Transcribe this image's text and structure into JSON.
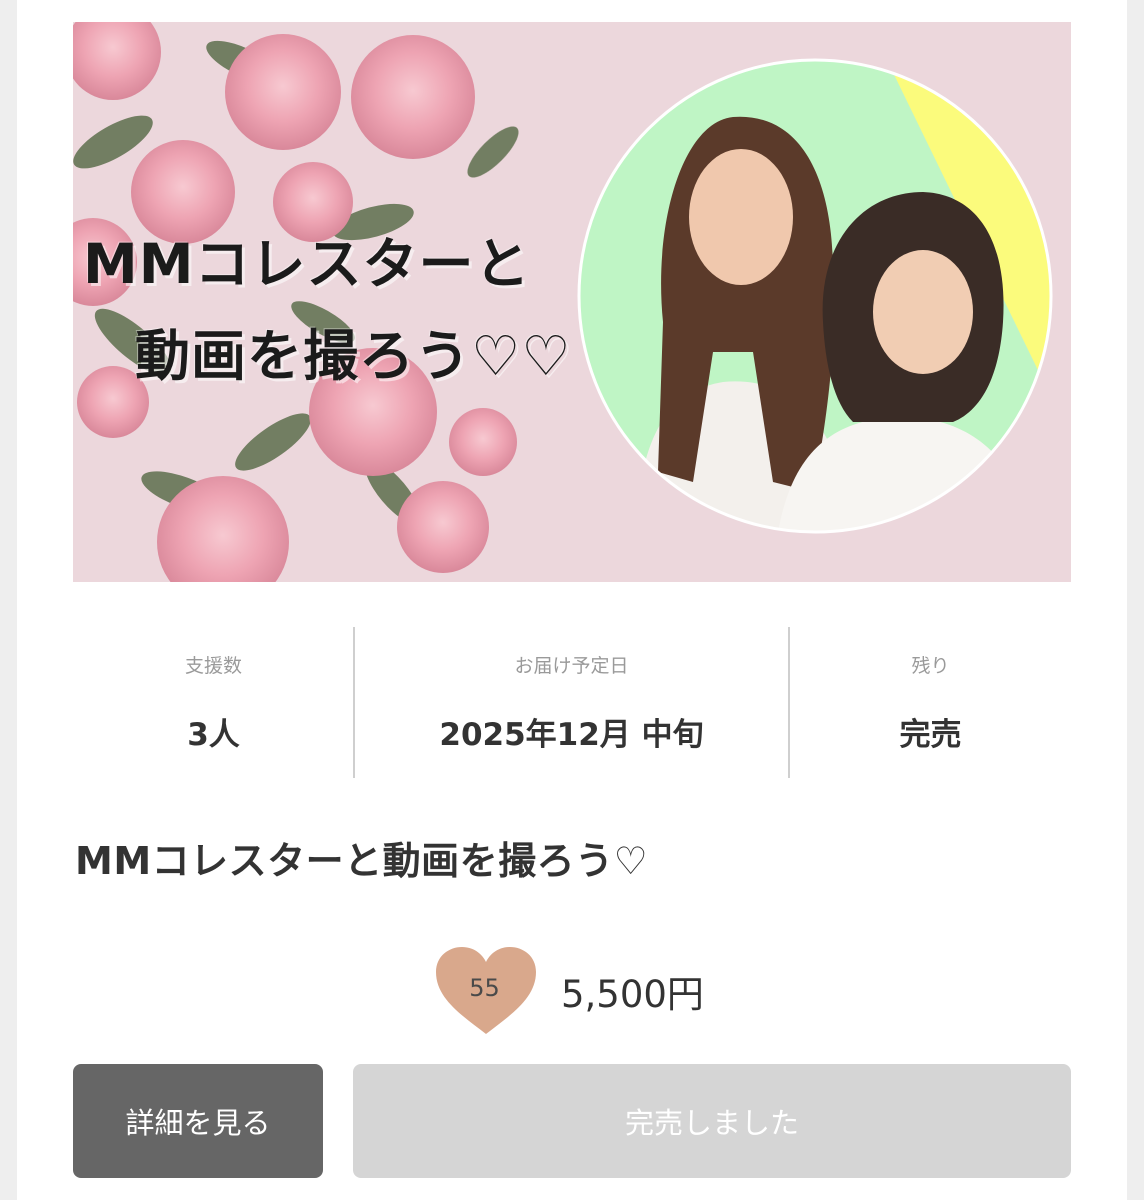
{
  "banner": {
    "title_line1": "MMコレスターと",
    "title_line2": "動画を撮ろう♡♡"
  },
  "stats": {
    "supporters": {
      "label": "支援数",
      "value": "3人"
    },
    "delivery": {
      "label": "お届け予定日",
      "value": "2025年12月 中旬"
    },
    "remaining": {
      "label": "残り",
      "value": "完売"
    }
  },
  "item": {
    "title": "MMコレスターと動画を撮ろう♡",
    "heart_count": "55",
    "price": "5,500円"
  },
  "buttons": {
    "detail": "詳細を見る",
    "sold_out": "完売しました"
  },
  "colors": {
    "detail_button": "#666666",
    "soldout_button": "#d5d5d5",
    "heart": "#d9a88c",
    "banner_bg": "#ecd7dc",
    "circle_green": "#bff5c5",
    "circle_yellow": "#fbfb7c"
  }
}
